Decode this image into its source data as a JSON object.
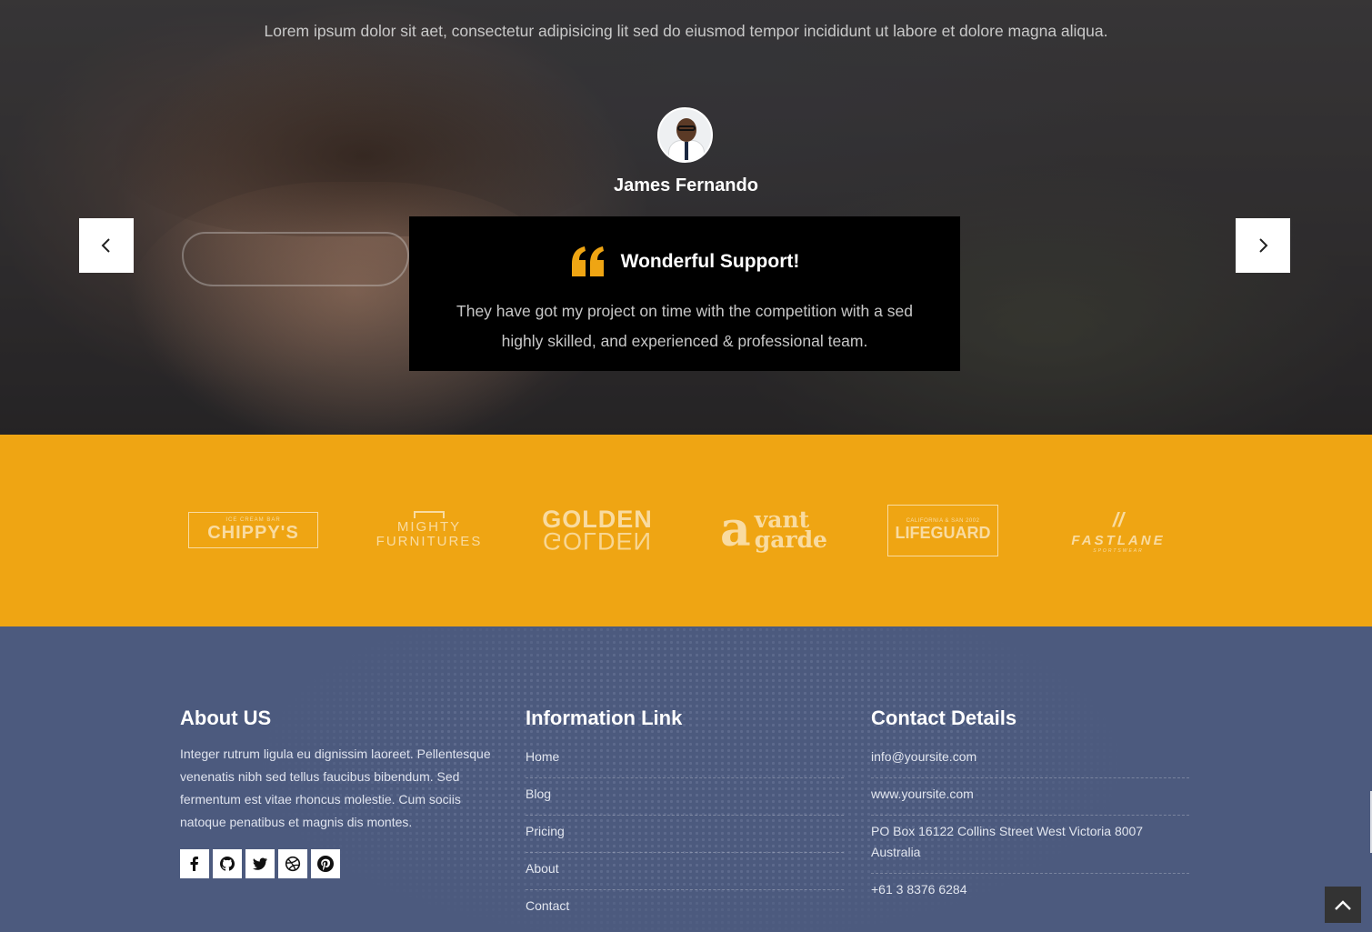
{
  "testimonial": {
    "intro": "Lorem ipsum dolor sit aet, consectetur adipisicing lit sed do eiusmod tempor incididunt ut labore et dolore magna aliqua.",
    "name": "James Fernando",
    "quote_title": "Wonderful Support!",
    "quote_text": "They have got my project on time with the competition with a sed highly skilled, and experienced & professional team.",
    "quote_icon": "quote-icon",
    "accent_color": "#efa513",
    "prev_icon": "chevron-left-icon",
    "next_icon": "chevron-right-icon"
  },
  "brands": {
    "background": "#efa513",
    "items": [
      {
        "small": "ICE CREAM BAR",
        "name": "CHIPPY'S"
      },
      {
        "line1": "MIGHTY",
        "line2": "FURNITURES"
      },
      {
        "name": "GOLDEN",
        "mirror": "GOLDEN"
      },
      {
        "letter": "a",
        "line1": "vant",
        "line2": "garde"
      },
      {
        "small": "CALIFORNIA & SAN 2002",
        "name": "LIFEGUARD"
      },
      {
        "mark": "//",
        "name": "FASTLANE",
        "small": "SPORTSWEAR"
      }
    ]
  },
  "footer": {
    "background": "#4c5a7e",
    "about": {
      "title": "About US",
      "text": "Integer rutrum ligula eu dignissim laoreet. Pellentesque venenatis nibh sed tellus faucibus bibendum. Sed fermentum est vitae rhoncus molestie. Cum sociis natoque penatibus et magnis dis montes.",
      "social": [
        "facebook-icon",
        "github-icon",
        "twitter-icon",
        "dribbble-icon",
        "pinterest-icon"
      ]
    },
    "links": {
      "title": "Information Link",
      "items": [
        "Home",
        "Blog",
        "Pricing",
        "About",
        "Contact"
      ]
    },
    "contact": {
      "title": "Contact Details",
      "email": "info@yoursite.com",
      "website": "www.yoursite.com",
      "address": "PO Box 16122 Collins Street West Victoria 8007 Australia",
      "phone": "+61 3 8376 6284"
    }
  },
  "scroll_top_icon": "chevron-up-icon"
}
